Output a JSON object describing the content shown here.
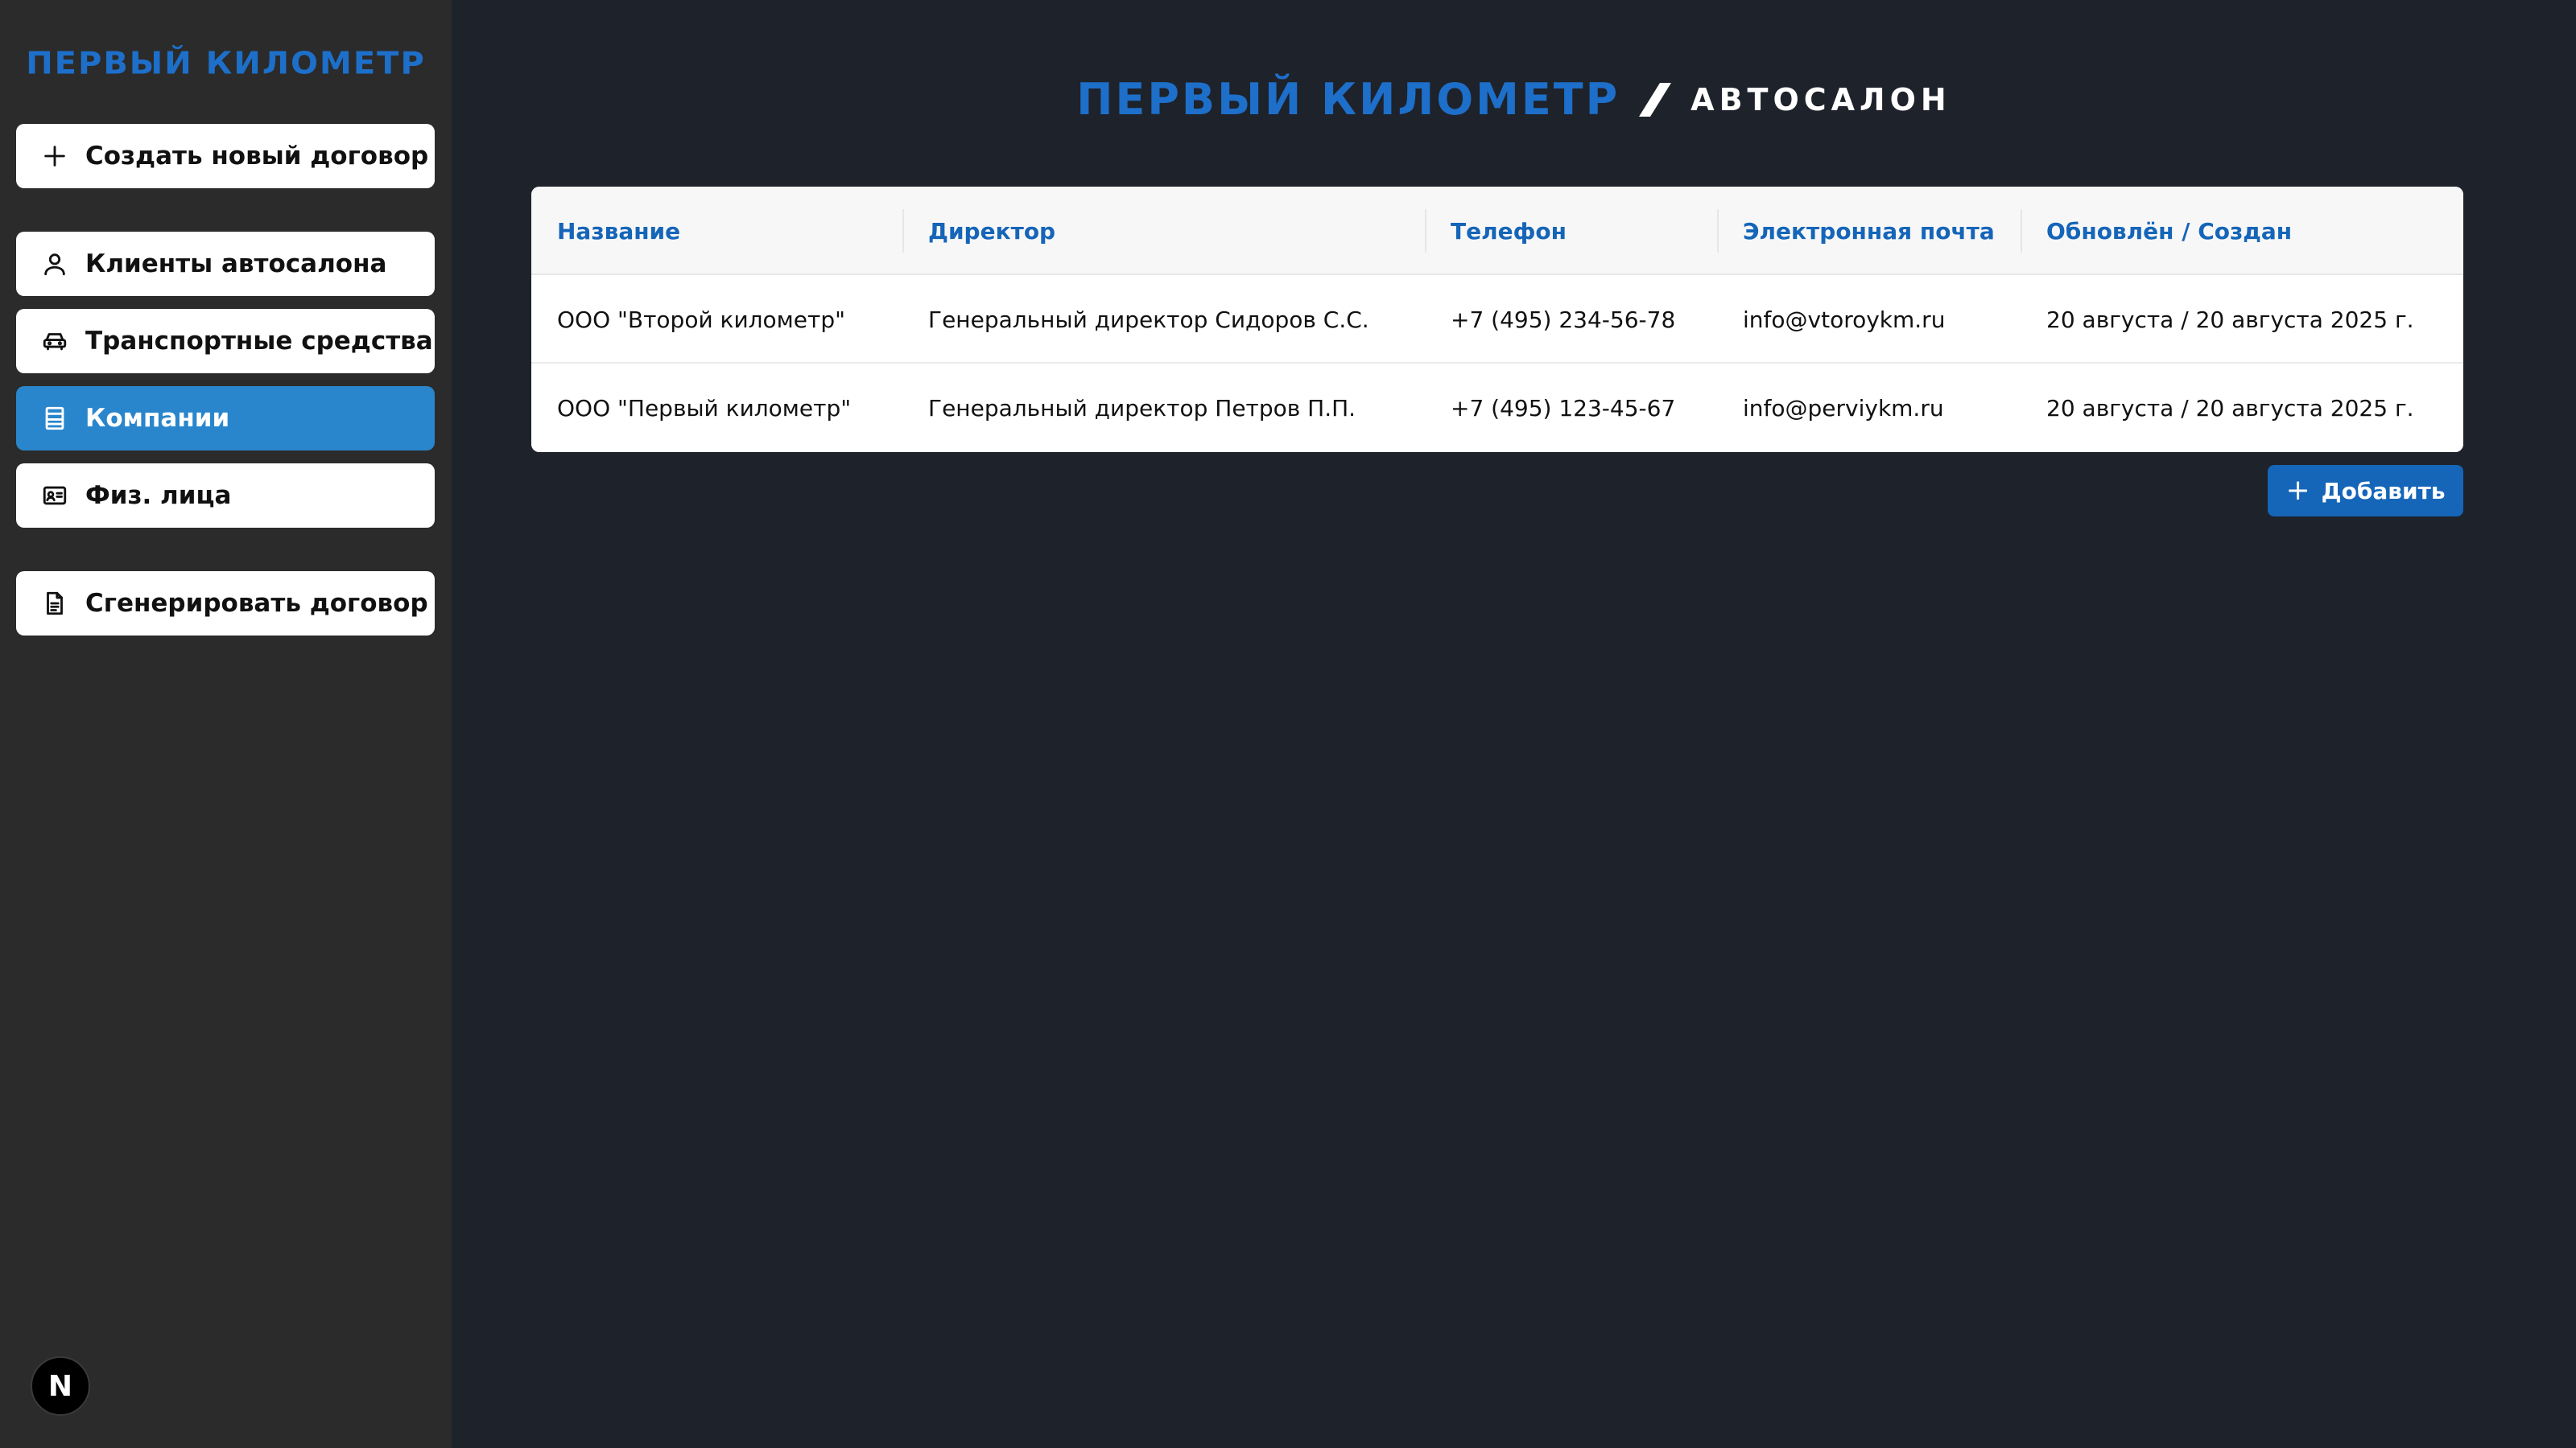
{
  "sidebar": {
    "logo": "ПЕРВЫЙ КИЛОМЕТР",
    "create_contract": "Создать новый договор",
    "nav": [
      {
        "label": "Клиенты автосалона",
        "icon": "user-icon"
      },
      {
        "label": "Транспортные средства",
        "icon": "car-icon"
      },
      {
        "label": "Компании",
        "icon": "building-icon",
        "active": true
      },
      {
        "label": "Физ. лица",
        "icon": "id-card-icon"
      }
    ],
    "generate_contract": "Сгенерировать договор",
    "badge": "N"
  },
  "header": {
    "brand": "ПЕРВЫЙ КИЛОМЕТР",
    "section": "АВТОСАЛОН"
  },
  "table": {
    "columns": [
      "Название",
      "Директор",
      "Телефон",
      "Электронная почта",
      "Обновлён / Создан"
    ],
    "rows": [
      {
        "name": "ООО \"Второй километр\"",
        "director": "Генеральный директор Сидоров С.С.",
        "phone": "+7 (495) 234-56-78",
        "email": "info@vtoroykm.ru",
        "dates": "20 августа / 20 августа 2025 г."
      },
      {
        "name": "ООО \"Первый километр\"",
        "director": "Генеральный директор Петров П.П.",
        "phone": "+7 (495) 123-45-67",
        "email": "info@perviykm.ru",
        "dates": "20 августа / 20 августа 2025 г."
      }
    ]
  },
  "actions": {
    "add_label": "Добавить"
  },
  "colors": {
    "accent": "#1d6fc9",
    "active_nav": "#2a86cc",
    "background": "#1e222b",
    "sidebar": "#2b2b2b"
  }
}
